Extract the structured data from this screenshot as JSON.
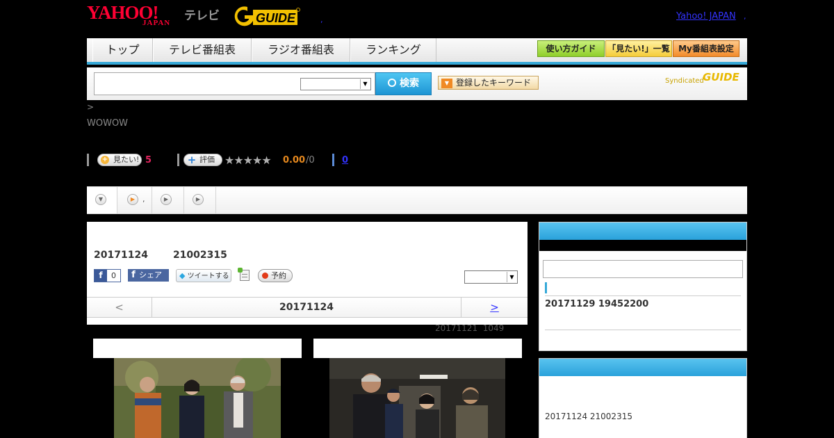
{
  "header": {
    "logo_yahoo": "YAHOO!",
    "logo_japan": "JAPAN",
    "logo_tv": "テレビ",
    "logo_gguide": "GUIDE",
    "dot": ",",
    "yahoo_japan_link": "Yahoo! JAPAN",
    "link_dot": ","
  },
  "nav": {
    "tabs": [
      "トップ",
      "テレビ番組表",
      "ラジオ番組表",
      "ランキング"
    ],
    "buttons": [
      "使い方ガイド",
      "「見たい!」一覧",
      "My番組表設定"
    ]
  },
  "search": {
    "button_label": "検索",
    "keyword_button": "登録したキーワード",
    "syndicated": "Syndicated",
    "syndicated_logo": "GUIDE"
  },
  "breadcrumb": ">",
  "channel": "WOWOW",
  "actions": {
    "want_label": "見たい!",
    "want_count": "5",
    "rate_label": "評価",
    "stars": "★★★★★",
    "score": "0.00",
    "score_count": "/0",
    "review_count": "0"
  },
  "subtabs": {
    "tab2_dot": ","
  },
  "program": {
    "date": "20171124",
    "time": "21002315",
    "fb_count": "0",
    "fb_share": "シェア",
    "tweet": "ツイートする",
    "reserve": "予約",
    "day_prev": "<",
    "day_current": "20171124",
    "day_next": ">",
    "updated_date": "20171121",
    "updated_time": "1049"
  },
  "sidebar": {
    "related": "20171129  19452200",
    "broadcast": "20171124  21002315"
  },
  "colors": {
    "accent_blue": "#36a9d8",
    "brand_red": "#ff0033",
    "score_orange": "#e7891e"
  }
}
